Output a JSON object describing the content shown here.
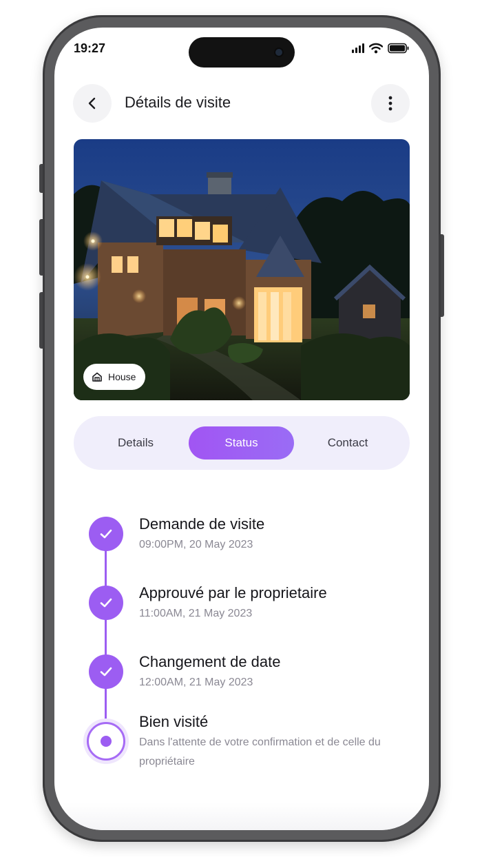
{
  "status_bar": {
    "time": "19:27"
  },
  "header": {
    "title": "Détails de visite"
  },
  "hero": {
    "tag_label": "House"
  },
  "tabs": [
    {
      "label": "Details",
      "active": false
    },
    {
      "label": "Status",
      "active": true
    },
    {
      "label": "Contact",
      "active": false
    }
  ],
  "timeline": [
    {
      "title": "Demande de visite",
      "subtitle": "09:00PM, 20 May 2023",
      "state": "done"
    },
    {
      "title": "Approuvé par le proprietaire",
      "subtitle": "11:00AM, 21 May 2023",
      "state": "done"
    },
    {
      "title": "Changement de date",
      "subtitle": "12:00AM, 21 May 2023",
      "state": "done"
    },
    {
      "title": "Bien visité",
      "subtitle": "Dans l'attente de votre confirmation et de celle du propriétaire",
      "state": "current"
    }
  ],
  "colors": {
    "accent": "#9c5df2",
    "tabs_bg": "#f0eefb"
  }
}
